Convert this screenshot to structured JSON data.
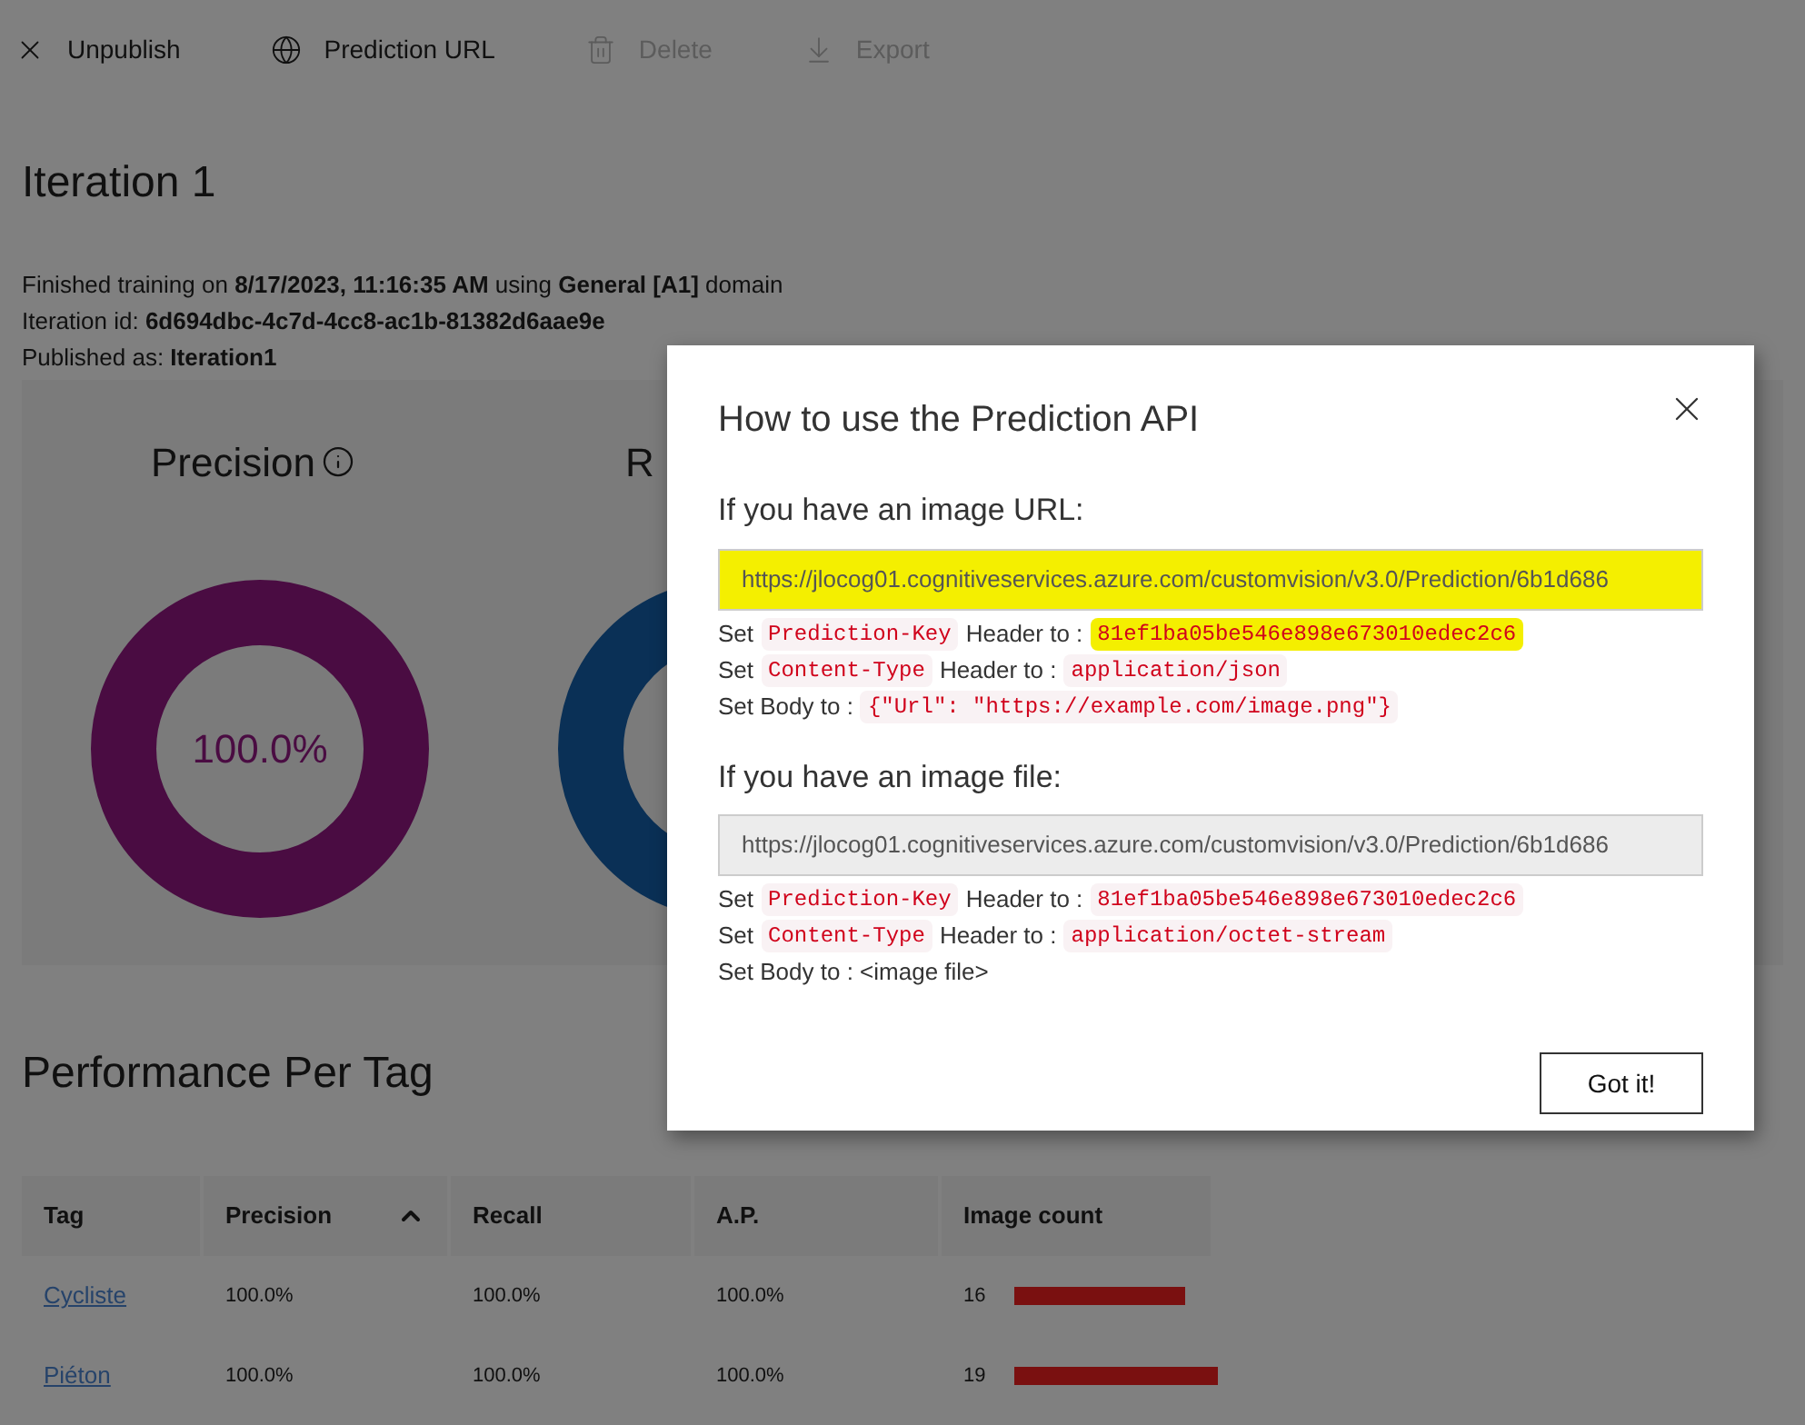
{
  "toolbar": [
    {
      "kind": "close",
      "label": "Unpublish",
      "disabled": false
    },
    {
      "kind": "globe",
      "label": "Prediction URL",
      "disabled": false
    },
    {
      "kind": "trash",
      "label": "Delete",
      "disabled": true
    },
    {
      "kind": "download",
      "label": "Export",
      "disabled": true
    }
  ],
  "iteration": {
    "title": "Iteration 1",
    "info": [
      "Finished training on **8/17/2023, 11:16:35 AM** using **General [A1]** domain",
      "Iteration id: **6d694dbc-4c7d-4cc8-ac1b-81382d6aae9e**",
      "Published as: **Iteration1**"
    ]
  },
  "metrics": [
    {
      "title": "Precision",
      "info_icon": true,
      "value": "100.0%",
      "level": 1,
      "color": "#4a0c42"
    },
    {
      "title": "R",
      "color": "#0a3056"
    }
  ],
  "performance": {
    "title": "Performance Per Tag",
    "columns": [
      {
        "label": "Tag",
        "sorted": false
      },
      {
        "label": "Precision",
        "sorted": true
      },
      {
        "label": "Recall",
        "sorted": false
      },
      {
        "label": "A.P.",
        "sorted": false
      },
      {
        "label": "Image count",
        "sorted": false
      }
    ],
    "rows": [
      {
        "tag": "Cycliste",
        "precision": "100.0%",
        "recall": "100.0%",
        "ap": "100.0%",
        "count": "16",
        "level": 0.84
      },
      {
        "tag": "Piéton",
        "precision": "100.0%",
        "recall": "100.0%",
        "ap": "100.0%",
        "count": "19",
        "level": 1
      }
    ]
  },
  "dialog": {
    "title": "How to use the Prediction API",
    "sections": [
      {
        "heading": "If you have an image URL:",
        "url": "https://jlocog01.cognitiveservices.azure.com/customvision/v3.0/Prediction/6b1d686",
        "highlighted": true,
        "lines": [
          {
            "prefix": "Set",
            "code1": "Prediction-Key",
            "middle": "Header to :",
            "code2": "81ef1ba05be546e898e673010edec2c6",
            "highlighted": true
          },
          {
            "prefix": "Set",
            "code1": "Content-Type",
            "middle": "Header to :",
            "code2": "application/json",
            "highlighted": false
          },
          {
            "prefix": "Set Body to :",
            "code2": "{\"Url\": \"https://example.com/image.png\"}",
            "highlighted": false
          }
        ]
      },
      {
        "heading": "If you have an image file:",
        "url": "https://jlocog01.cognitiveservices.azure.com/customvision/v3.0/Prediction/6b1d686",
        "highlighted": false,
        "lines": [
          {
            "prefix": "Set",
            "code1": "Prediction-Key",
            "middle": "Header to :",
            "code2": "81ef1ba05be546e898e673010edec2c6",
            "highlighted": false
          },
          {
            "prefix": "Set",
            "code1": "Content-Type",
            "middle": "Header to :",
            "code2": "application/octet-stream",
            "highlighted": false
          },
          {
            "prefix": "Set Body to : <image file>"
          }
        ]
      }
    ],
    "button": "Got it!"
  }
}
